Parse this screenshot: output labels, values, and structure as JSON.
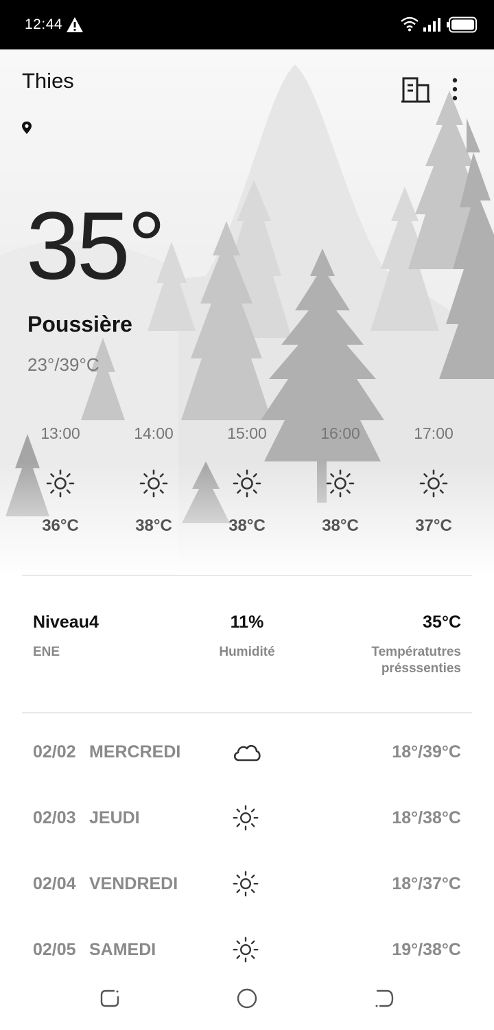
{
  "status_bar": {
    "time": "12:44",
    "icons": [
      "warning-icon",
      "wifi-icon",
      "signal-icon",
      "battery-icon"
    ]
  },
  "header": {
    "city": "Thies",
    "icons": [
      "location-pin-icon",
      "city-list-icon",
      "more-vert-icon"
    ]
  },
  "current": {
    "temperature": "35°",
    "condition": "Poussière",
    "range": "23°/39°C"
  },
  "hourly": [
    {
      "time": "13:00",
      "icon": "sun-icon",
      "temp": "36°C"
    },
    {
      "time": "14:00",
      "icon": "sun-icon",
      "temp": "38°C"
    },
    {
      "time": "15:00",
      "icon": "sun-icon",
      "temp": "38°C"
    },
    {
      "time": "16:00",
      "icon": "sun-icon",
      "temp": "38°C"
    },
    {
      "time": "17:00",
      "icon": "sun-icon",
      "temp": "37°C"
    }
  ],
  "details": {
    "wind": {
      "value": "Niveau4",
      "label": "ENE"
    },
    "humidity": {
      "value": "11%",
      "label": "Humidité"
    },
    "feels_like": {
      "value": "35°C",
      "label_line1": "Températutres",
      "label_line2": "présssenties"
    }
  },
  "daily": [
    {
      "date": "02/02",
      "day": "MERCREDI",
      "icon": "cloud-icon",
      "range": "18°/39°C"
    },
    {
      "date": "02/03",
      "day": "JEUDI",
      "icon": "sun-icon",
      "range": "18°/38°C"
    },
    {
      "date": "02/04",
      "day": "VENDREDI",
      "icon": "sun-icon",
      "range": "18°/37°C"
    },
    {
      "date": "02/05",
      "day": "SAMEDI",
      "icon": "sun-icon",
      "range": "19°/38°C"
    }
  ],
  "nav_bar": {
    "icons": [
      "recents-icon",
      "home-icon",
      "back-icon"
    ]
  },
  "colors": {
    "status_bar_bg": "#000000",
    "primary_text": "#111111",
    "secondary_text": "#8a8a8a"
  }
}
